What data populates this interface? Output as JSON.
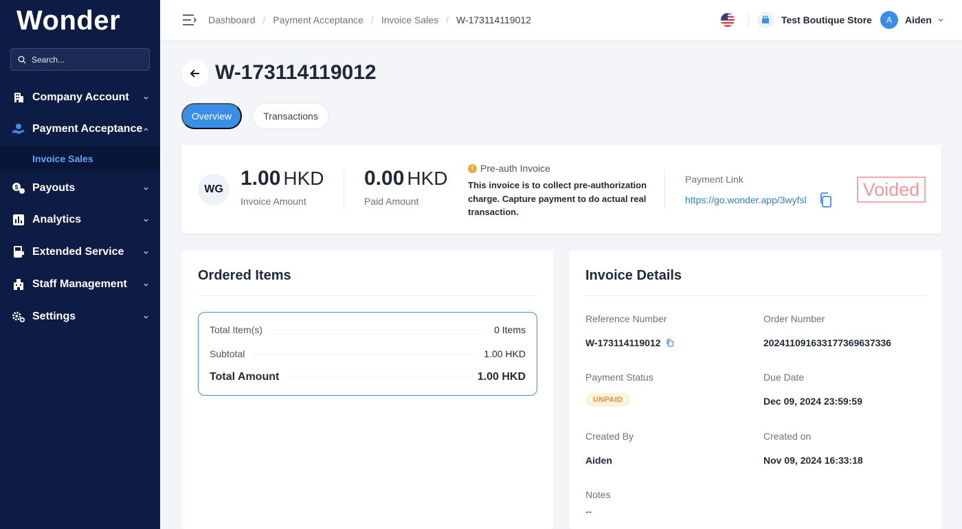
{
  "sidebar": {
    "logo": "Wonder",
    "search_placeholder": "Search...",
    "items": [
      {
        "label": "Company Account",
        "icon": "building-icon"
      },
      {
        "label": "Payment Acceptance",
        "icon": "hand-coin-icon"
      },
      {
        "label": "Payouts",
        "icon": "payouts-icon"
      },
      {
        "label": "Analytics",
        "icon": "bar-chart-icon"
      },
      {
        "label": "Extended Service",
        "icon": "terminal-icon"
      },
      {
        "label": "Staff Management",
        "icon": "staff-icon"
      },
      {
        "label": "Settings",
        "icon": "gear-icon"
      }
    ],
    "sub_item": "Invoice Sales"
  },
  "topbar": {
    "breadcrumb": [
      "Dashboard",
      "Payment Acceptance",
      "Invoice Sales",
      "W-173114119012"
    ],
    "store_name": "Test Boutique Store",
    "user_initial": "A",
    "user_name": "Aiden"
  },
  "page": {
    "title": "W-173114119012",
    "tabs": [
      "Overview",
      "Transactions"
    ]
  },
  "summary": {
    "avatar": "WG",
    "invoice_amount": "1.00",
    "invoice_currency": "HKD",
    "invoice_caption": "Invoice Amount",
    "paid_amount": "0.00",
    "paid_currency": "HKD",
    "paid_caption": "Paid Amount",
    "preauth_title": "Pre-auth Invoice",
    "preauth_text": "This invoice is to collect pre-authorization charge. Capture payment to do actual real transaction.",
    "payment_link_label": "Payment Link",
    "payment_link": "https://go.wonder.app/3wyfsl",
    "status_stamp": "Voided"
  },
  "ordered": {
    "title": "Ordered Items",
    "total_items_label": "Total Item(s)",
    "total_items_value": "0 Items",
    "subtotal_label": "Subtotal",
    "subtotal_value": "1.00 HKD",
    "total_label": "Total Amount",
    "total_value": "1.00 HKD"
  },
  "details": {
    "title": "Invoice Details",
    "reference_label": "Reference Number",
    "reference_value": "W-173114119012",
    "order_label": "Order Number",
    "order_value": "202411091633177369637336",
    "payment_status_label": "Payment Status",
    "payment_status_value": "UNPAID",
    "due_label": "Due Date",
    "due_value": "Dec 09, 2024 23:59:59",
    "created_by_label": "Created By",
    "created_by_value": "Aiden",
    "created_on_label": "Created on",
    "created_on_value": "Nov 09, 2024 16:33:18",
    "notes_label": "Notes",
    "notes_value": "--"
  },
  "colors": {
    "sidebar_bg": "#0c1c45",
    "accent": "#3b8ee8",
    "link": "#2f80d7",
    "voided": "#ee979d",
    "unpaid_bg": "#fdf1e2",
    "unpaid_text": "#f0902f"
  }
}
